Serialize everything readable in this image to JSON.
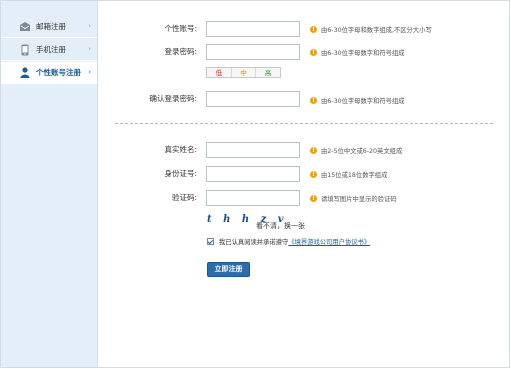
{
  "sidebar": {
    "items": [
      {
        "label": "邮箱注册",
        "icon": "mail-icon",
        "active": false
      },
      {
        "label": "手机注册",
        "icon": "phone-icon",
        "active": false
      },
      {
        "label": "个性账号注册",
        "icon": "user-icon",
        "active": true
      }
    ],
    "chevron": "›"
  },
  "form": {
    "username": {
      "label": "个性账号:",
      "value": "",
      "tip": "由6-30位字母和数字组成,不区分大小写"
    },
    "password": {
      "label": "登录密码:",
      "value": "",
      "tip": "由6-30位字母数字和符号组成"
    },
    "strength": {
      "weak": "低",
      "medium": "中",
      "strong": "高"
    },
    "confirm": {
      "label": "确认登录密码:",
      "value": "",
      "tip": "由6-30位字母数字和符号组成"
    },
    "realname": {
      "label": "真实姓名:",
      "value": "",
      "tip": "由2-5位中文或6-20英文组成"
    },
    "idcard": {
      "label": "身份证号:",
      "value": "",
      "tip": "由15位或18位数字组成"
    },
    "captcha": {
      "label": "验证码:",
      "value": "",
      "tip": "请填写图片中显示的验证码"
    },
    "captcha_text": "t h h z v",
    "refresh_label": "看不清，换一张",
    "agree_text": "我已认真阅读并承诺遵守",
    "agree_link": "《境界游戏公司用户协议书》",
    "submit_label": "立即注册"
  },
  "colors": {
    "sidebar_bg": "#e3eef8",
    "accent": "#1b5f9f",
    "tip_icon": "#f0a300",
    "weak": "#d9251d",
    "medium": "#e08a00",
    "strong": "#2f8f2f"
  }
}
